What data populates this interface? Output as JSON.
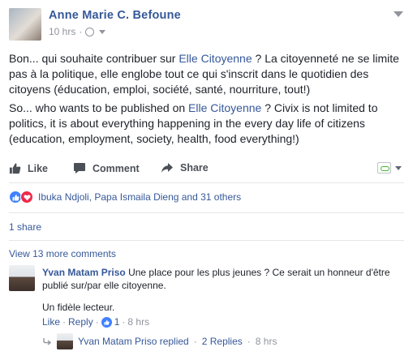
{
  "post": {
    "author": "Anne Marie C. Befoune",
    "time": "10 hrs",
    "privacy_sep": "·",
    "paragraph1": {
      "before": "Bon... qui souhaite contribuer sur ",
      "link": "Elle Citoyenne",
      "after": " ? La citoyenneté ne se limite pas à la politique, elle englobe tout ce qui s'inscrit dans le quotidien des citoyens (éducation, emploi, société, santé, nourriture, tout!)"
    },
    "paragraph2": {
      "before": "So... who wants to be published on ",
      "link": "Elle Citoyenne",
      "after": " ? Civix is not limited to politics, it is about everything happening in the every day life of citizens (education, employment, society, health, food everything!)"
    }
  },
  "actions": {
    "like": "Like",
    "comment": "Comment",
    "share": "Share"
  },
  "reactions": {
    "names": "Ibuka Ndjoli, Papa Ismaila Dieng and 31 others"
  },
  "shares": "1 share",
  "comments": {
    "view_more": "View 13 more comments",
    "first": {
      "author": "Yvan Matam Priso",
      "text": "Une place pour les plus jeunes ? Ce serait un honneur d'être publié sur/par elle citoyenne.",
      "text2": "Un fidèle lecteur.",
      "like": "Like",
      "reply": "Reply",
      "sep": "·",
      "like_count": "1",
      "time": "8 hrs"
    },
    "replies": {
      "summary": "Yvan Matam Priso replied",
      "sep": "·",
      "count": "2 Replies",
      "time": "8 hrs"
    }
  },
  "colors": {
    "link": "#365899",
    "meta": "#90949c",
    "like_blue": "#4080ff",
    "love_red": "#f0284a"
  }
}
